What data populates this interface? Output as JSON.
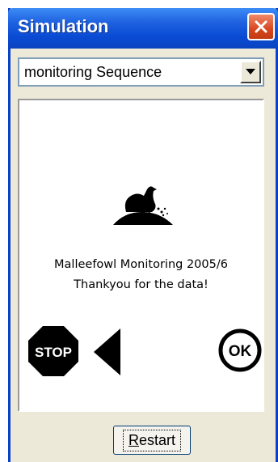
{
  "window": {
    "title": "Simulation",
    "close_icon": "close-icon"
  },
  "dropdown": {
    "selected": "monitoring Sequence",
    "arrow_icon": "chevron-down-icon"
  },
  "panel": {
    "image_icon": "malleefowl-bird-icon",
    "message_line1": "Malleefowl Monitoring 2005/6",
    "message_line2": "Thankyou for the data!",
    "stop_label": "STOP",
    "back_icon": "back-arrow-icon",
    "ok_label": "OK"
  },
  "restart_button": {
    "label": "Restart"
  },
  "colors": {
    "titlebar": "#0a4bd4",
    "close_button": "#d8471f",
    "window_bg": "#ece9d8"
  }
}
